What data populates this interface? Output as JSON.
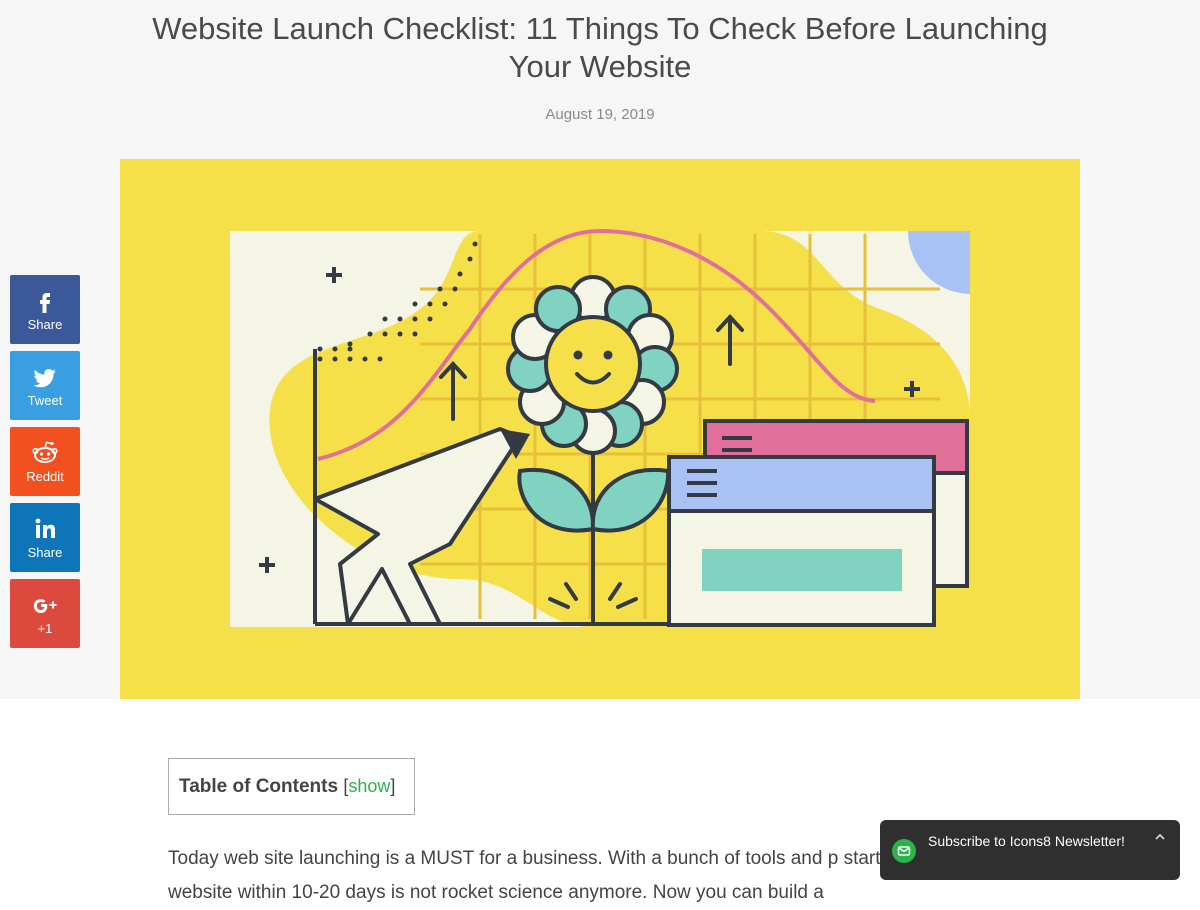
{
  "article": {
    "title": "Website Launch Checklist: 11 Things To Check Before Launching Your Website",
    "date": "August 19, 2019"
  },
  "share_bar": {
    "facebook": {
      "label": "Share",
      "icon": "facebook-icon",
      "color": "#3b5998"
    },
    "twitter": {
      "label": "Tweet",
      "icon": "twitter-icon",
      "color": "#3a9fe0"
    },
    "reddit": {
      "label": "Reddit",
      "icon": "reddit-icon",
      "color": "#f2501f"
    },
    "linkedin": {
      "label": "Share",
      "icon": "linkedin-icon",
      "color": "#0e76b8"
    },
    "googleplus": {
      "label": "+1",
      "icon": "google-plus-icon",
      "color": "#dc4a3d"
    }
  },
  "toc": {
    "title": "Table of Contents",
    "bracket_open": "[",
    "toggle": "show",
    "bracket_close": "]"
  },
  "body": {
    "paragraph": "Today web site launching is a MUST for a business. With a bunch of tools and p starting a website within 10-20 days is not rocket science anymore. Now you can build a"
  },
  "newsletter": {
    "text": "Subscribe to Icons8 Newsletter!",
    "icon": "mail-icon",
    "chevron": "chevron-up-icon"
  },
  "colors": {
    "hero_background": "#f6e04a",
    "accent_green": "#2ab34b",
    "header_background": "#f6f6f6"
  }
}
